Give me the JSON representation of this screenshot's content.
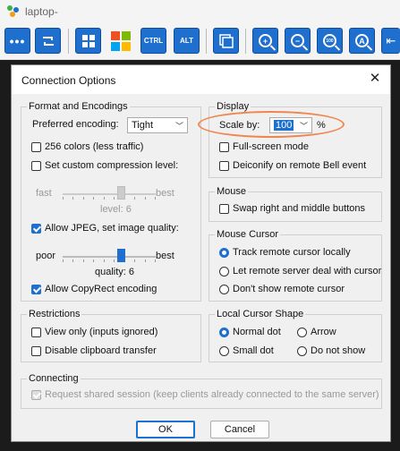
{
  "window": {
    "title": "laptop-"
  },
  "toolbar": {
    "ctrl_label": "CTRL",
    "alt_label": "ALT",
    "zoom_100_label": "100"
  },
  "dialog": {
    "title": "Connection Options",
    "ok_label": "OK",
    "cancel_label": "Cancel",
    "format": {
      "title": "Format and Encodings",
      "preferred_label": "Preferred encoding:",
      "preferred_value": "Tight",
      "colors256": "256 colors (less traffic)",
      "custom_compression": "Set custom compression level:",
      "fast": "fast",
      "best": "best",
      "level_label": "level: 6",
      "jpeg_label": "Allow JPEG, set image quality:",
      "poor": "poor",
      "best2": "best",
      "quality_label": "quality: 6",
      "copyrect_label": "Allow CopyRect encoding",
      "level_value": 6,
      "quality_value": 6
    },
    "restrictions": {
      "title": "Restrictions",
      "view_only": "View only (inputs ignored)",
      "disable_clipboard": "Disable clipboard transfer"
    },
    "display": {
      "title": "Display",
      "scale_label": "Scale by:",
      "scale_value": "100",
      "percent": "%",
      "fullscreen": "Full-screen mode",
      "deiconify": "Deiconify on remote Bell event"
    },
    "mouse": {
      "title": "Mouse",
      "swap_buttons": "Swap right and middle buttons"
    },
    "mouse_cursor": {
      "title": "Mouse Cursor",
      "track": "Track remote cursor locally",
      "let_server": "Let remote server deal with cursor",
      "dont_show": "Don't show remote cursor"
    },
    "local_cursor": {
      "title": "Local Cursor Shape",
      "normal_dot": "Normal dot",
      "arrow": "Arrow",
      "small_dot": "Small dot",
      "do_not_show": "Do not show"
    },
    "connecting": {
      "title": "Connecting",
      "shared": "Request shared session (keep clients already connected to the same server)"
    }
  },
  "colors": {
    "accent": "#1e6fce",
    "highlight": "#f0864f"
  }
}
